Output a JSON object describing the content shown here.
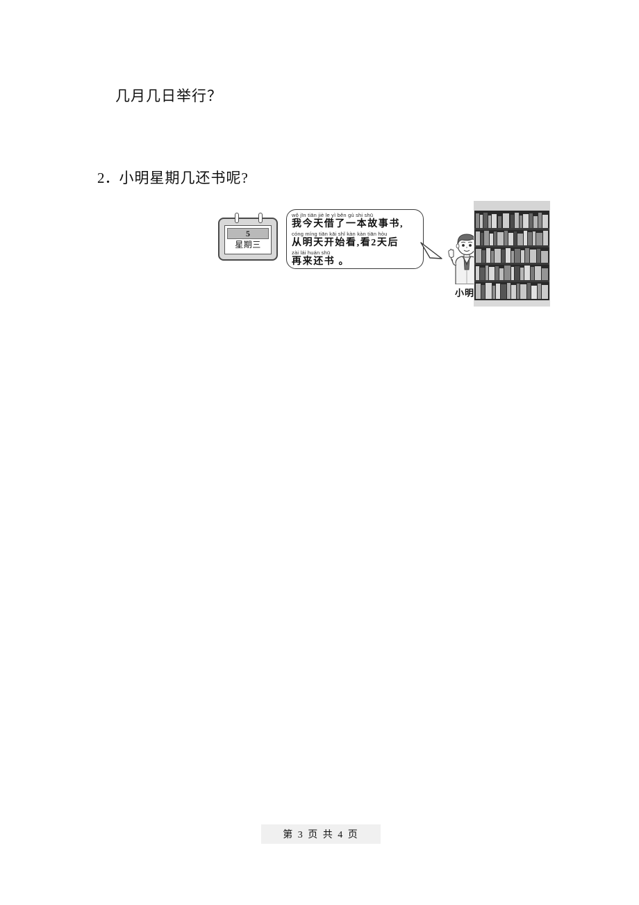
{
  "document": {
    "page_number": "3",
    "total_pages": "4",
    "footer": "第 3 页 共 4 页"
  },
  "questions": {
    "carryover_line": "几月几日举行？",
    "q2": {
      "number": "2．",
      "text": "小明星期几还书呢?"
    }
  },
  "illustration": {
    "calendar": {
      "day_number": "5",
      "weekday": "星期三"
    },
    "speech_bubble": {
      "lines": [
        {
          "pinyin": "wǒ jīn tiān jiè le  yì běn gù  shi shū",
          "hanzi": "我今天借了一本故事书,"
        },
        {
          "pinyin": "cóng míng tiān kāi shǐ  kàn  kàn     tiān hòu",
          "hanzi": "从明天开始看,看2天后"
        },
        {
          "pinyin": "zài   lái huán shū",
          "hanzi": "再来还书 。"
        }
      ]
    },
    "character": {
      "name": "小明"
    },
    "bookshelf": {
      "alt": "bookshelf-photo"
    }
  },
  "colors": {
    "page_background": "#ffffff",
    "text": "#111111",
    "calendar_frame": "#d8d8d8",
    "calendar_band": "#b9b9b9",
    "footer_band": "#f0f0f0"
  }
}
